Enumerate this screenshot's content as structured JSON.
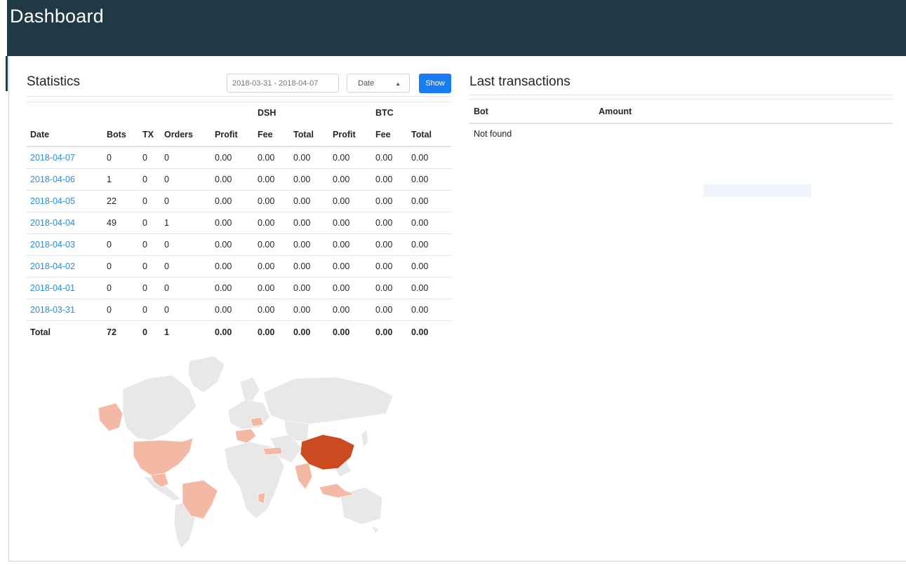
{
  "header": {
    "title": "Dashboard"
  },
  "statistics": {
    "title": "Statistics",
    "date_range_value": "2018-03-31 - 2018-04-07",
    "group_select_value": "Date",
    "show_label": "Show",
    "group_headers": {
      "dsh": "DSH",
      "btc": "BTC"
    },
    "columns": [
      "Date",
      "Bots",
      "TX",
      "Orders",
      "Profit",
      "Fee",
      "Total",
      "Profit",
      "Fee",
      "Total"
    ],
    "rows": [
      [
        "2018-04-07",
        "0",
        "0",
        "0",
        "0.00",
        "0.00",
        "0.00",
        "0.00",
        "0.00",
        "0.00"
      ],
      [
        "2018-04-06",
        "1",
        "0",
        "0",
        "0.00",
        "0.00",
        "0.00",
        "0.00",
        "0.00",
        "0.00"
      ],
      [
        "2018-04-05",
        "22",
        "0",
        "0",
        "0.00",
        "0.00",
        "0.00",
        "0.00",
        "0.00",
        "0.00"
      ],
      [
        "2018-04-04",
        "49",
        "0",
        "1",
        "0.00",
        "0.00",
        "0.00",
        "0.00",
        "0.00",
        "0.00"
      ],
      [
        "2018-04-03",
        "0",
        "0",
        "0",
        "0.00",
        "0.00",
        "0.00",
        "0.00",
        "0.00",
        "0.00"
      ],
      [
        "2018-04-02",
        "0",
        "0",
        "0",
        "0.00",
        "0.00",
        "0.00",
        "0.00",
        "0.00",
        "0.00"
      ],
      [
        "2018-04-01",
        "0",
        "0",
        "0",
        "0.00",
        "0.00",
        "0.00",
        "0.00",
        "0.00",
        "0.00"
      ],
      [
        "2018-03-31",
        "0",
        "0",
        "0",
        "0.00",
        "0.00",
        "0.00",
        "0.00",
        "0.00",
        "0.00"
      ]
    ],
    "total": [
      "Total",
      "72",
      "0",
      "1",
      "0.00",
      "0.00",
      "0.00",
      "0.00",
      "0.00",
      "0.00"
    ]
  },
  "map": {
    "colors": {
      "base": "#e8e8e8",
      "border": "#ffffff",
      "low": "#f3b9a4",
      "high": "#cc4a1f"
    }
  },
  "transactions": {
    "title": "Last transactions",
    "columns": [
      "Bot",
      "Amount"
    ],
    "empty_text": "Not found"
  },
  "colors": {
    "topbar": "#213845",
    "accent": "#1a7cf3",
    "link": "#2b8ce0"
  }
}
